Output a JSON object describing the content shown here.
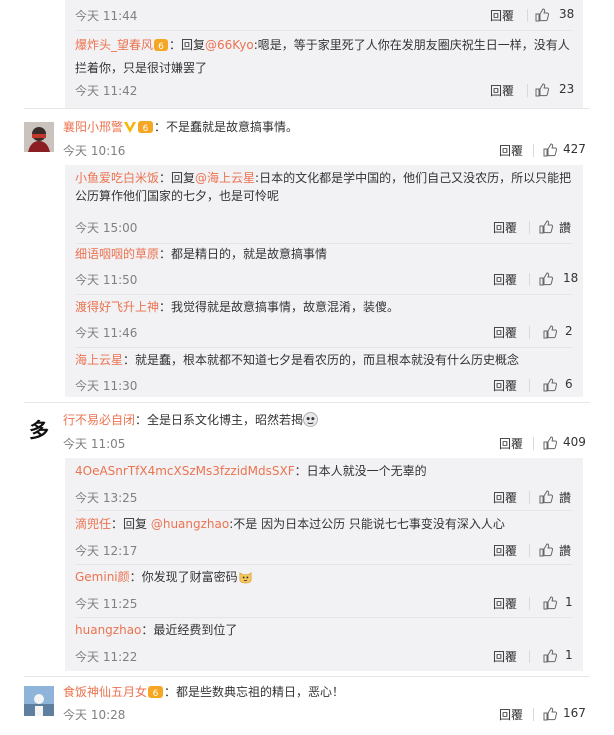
{
  "colors": {
    "username": "#eb7350",
    "reply_bg": "#f2f2f5",
    "meta": "#808080"
  },
  "top_box": {
    "reply0": {
      "time": "今天 11:44",
      "reply_label": "回覆",
      "likes": "38"
    },
    "reply1": {
      "user": "爆炸头_望春风",
      "prefix": "：回复",
      "mention": "@66Kyo",
      "text": ":嗯是，等于家里死了人你在发朋友圈庆祝生日一样，没有人拦着你，只是很讨嫌罢了",
      "time": "今天 11:42",
      "reply_label": "回覆",
      "likes": "23"
    }
  },
  "comment1": {
    "user": "襄阳小邢警",
    "text": "：不是蠢就是故意搞事情。",
    "time": "今天 10:16",
    "reply_label": "回覆",
    "likes": "427",
    "replies": [
      {
        "user": "小鱼爱吃白米饭",
        "prefix": "：回复",
        "mention": "@海上云星",
        "text": ":日本的文化都是学中国的，他们自己又没农历，所以只能把公历算作他们国家的七夕，也是可怜呢",
        "time": "今天 15:00",
        "reply_label": "回覆",
        "likes": "讚"
      },
      {
        "user": "细语咽咽的草原",
        "text": "：都是精日的，就是故意搞事情",
        "time": "今天 11:50",
        "reply_label": "回覆",
        "likes": "18"
      },
      {
        "user": "渡得好飞升上神",
        "text": "：我觉得就是故意搞事情，故意混淆，装傻。",
        "time": "今天 11:46",
        "reply_label": "回覆",
        "likes": "2"
      },
      {
        "user": "海上云星",
        "text": "：就是蠢，根本就都不知道七夕是看农历的，而且根本就没有什么历史概念",
        "time": "今天 11:30",
        "reply_label": "回覆",
        "likes": "6"
      }
    ]
  },
  "comment2": {
    "user": "行不易必自闭",
    "text": "：全是日系文化博主，昭然若揭",
    "time": "今天 11:05",
    "reply_label": "回覆",
    "likes": "409",
    "replies": [
      {
        "user": "4OeASnrTfX4mcXSzMs3fzzidMdsSXF",
        "text": "：日本人就没一个无辜的",
        "time": "今天 13:25",
        "reply_label": "回覆",
        "likes": "讚"
      },
      {
        "user": "滴兜任",
        "prefix": "：回复 ",
        "mention": "@huangzhao",
        "text": ":不是 因为日本过公历 只能说七七事变没有深入人心",
        "time": "今天 12:17",
        "reply_label": "回覆",
        "likes": "讚"
      },
      {
        "user": "Gemini颜",
        "text": "：你发现了财富密码",
        "time": "今天 11:25",
        "reply_label": "回覆",
        "likes": "1"
      },
      {
        "user": "huangzhao",
        "text": "：最近经费到位了",
        "time": "今天 11:22",
        "reply_label": "回覆",
        "likes": "1"
      }
    ]
  },
  "comment3": {
    "user": "食饭神仙五月女",
    "text": "：都是些数典忘祖的精日，恶心！",
    "time": "今天 10:28",
    "reply_label": "回覆",
    "likes": "167"
  }
}
